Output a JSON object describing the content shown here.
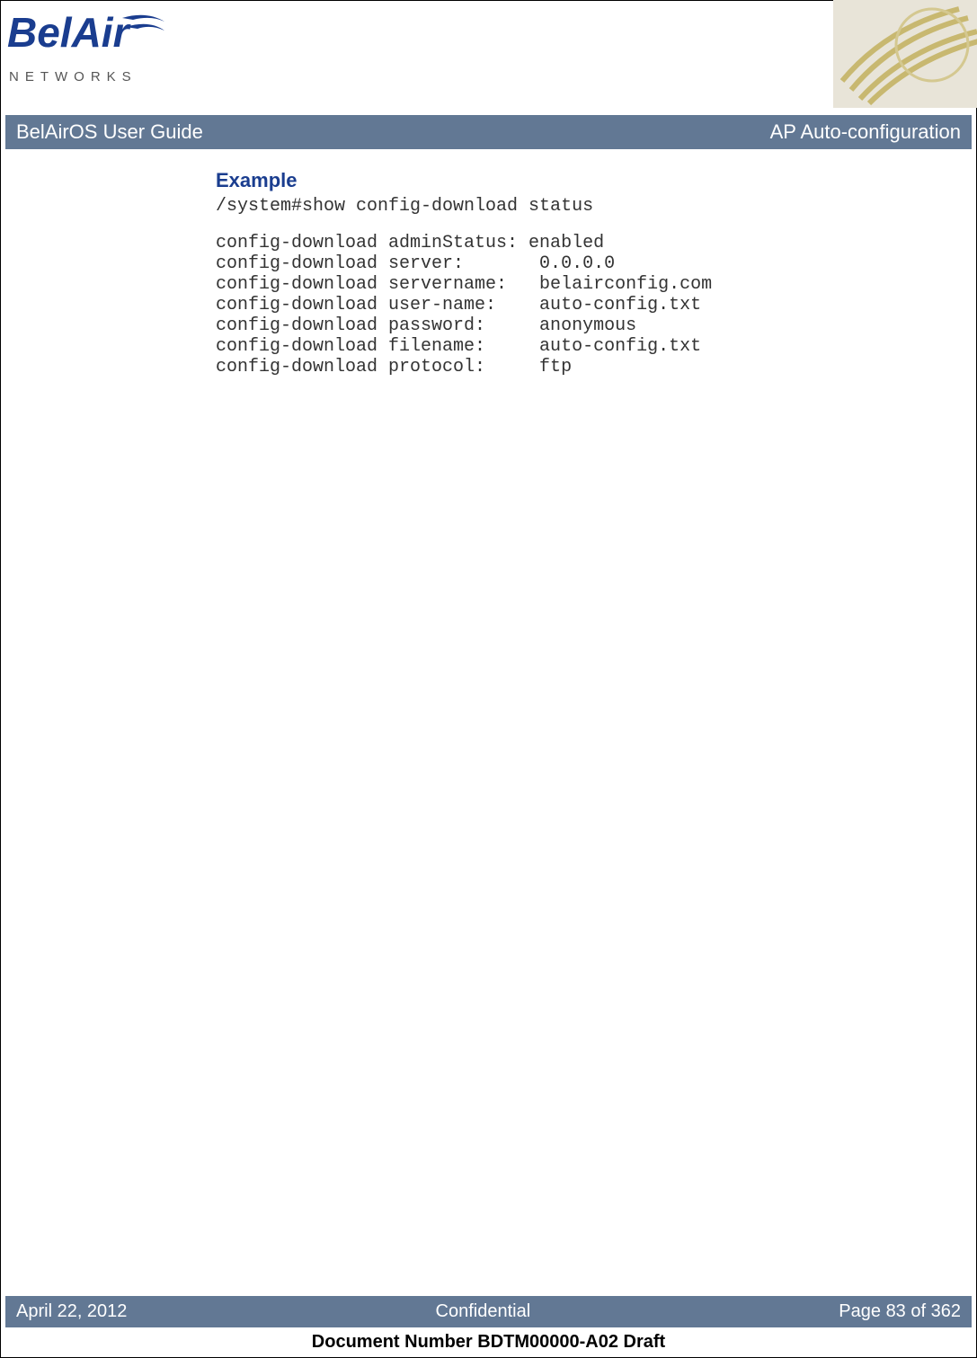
{
  "logo": {
    "line1": "BelAir",
    "line2": "N E T W O R K S"
  },
  "titleBar": {
    "left": "BelAirOS User Guide",
    "right": "AP Auto-configuration"
  },
  "content": {
    "exampleHeading": "Example",
    "codeLine1": "/system#show config-download status",
    "codeBlock": "config-download adminStatus: enabled\nconfig-download server:       0.0.0.0\nconfig-download servername:   belairconfig.com\nconfig-download user-name:    auto-config.txt\nconfig-download password:     anonymous\nconfig-download filename:     auto-config.txt\nconfig-download protocol:     ftp"
  },
  "footerBar": {
    "left": "April 22, 2012",
    "center": "Confidential",
    "right": "Page 83 of 362"
  },
  "docNumber": "Document Number BDTM00000-A02 Draft"
}
